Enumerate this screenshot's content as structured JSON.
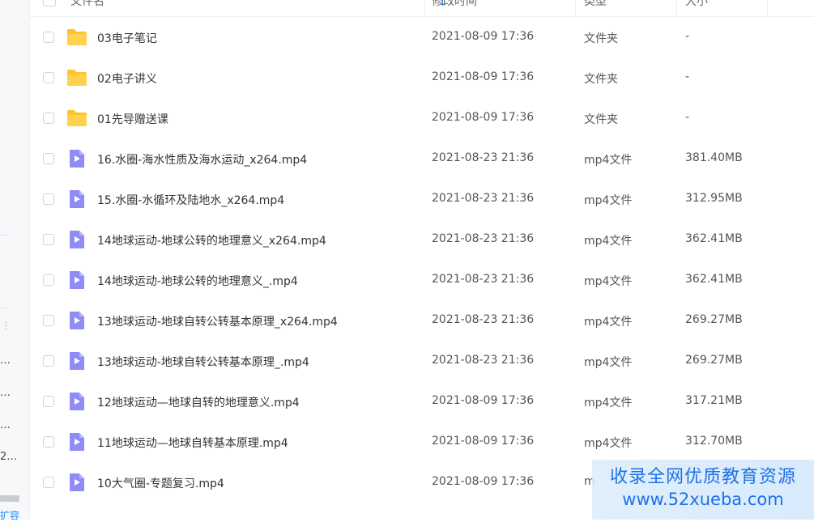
{
  "sidebar": {
    "fragments": [
      "…",
      "…",
      "…",
      "2…"
    ],
    "grip": "⋮",
    "bottom_link": "扩容"
  },
  "header": {
    "name": "文件名",
    "modified": "修改时间",
    "type": "类型",
    "size": "大小",
    "sort_icon": "↓"
  },
  "files": [
    {
      "name": "03电子笔记",
      "date": "2021-08-09 17:36",
      "type": "文件夹",
      "size": "-",
      "icon": "folder-icon"
    },
    {
      "name": "02电子讲义",
      "date": "2021-08-09 17:36",
      "type": "文件夹",
      "size": "-",
      "icon": "folder-icon"
    },
    {
      "name": "01先导赠送课",
      "date": "2021-08-09 17:36",
      "type": "文件夹",
      "size": "-",
      "icon": "folder-icon"
    },
    {
      "name": "16.水圈-海水性质及海水运动_x264.mp4",
      "date": "2021-08-23 21:36",
      "type": "mp4文件",
      "size": "381.40MB",
      "icon": "video-file-icon"
    },
    {
      "name": "15.水圈-水循环及陆地水_x264.mp4",
      "date": "2021-08-23 21:36",
      "type": "mp4文件",
      "size": "312.95MB",
      "icon": "video-file-icon"
    },
    {
      "name": "14地球运动-地球公转的地理意义_x264.mp4",
      "date": "2021-08-23 21:36",
      "type": "mp4文件",
      "size": "362.41MB",
      "icon": "video-file-icon"
    },
    {
      "name": "14地球运动-地球公转的地理意义_.mp4",
      "date": "2021-08-23 21:36",
      "type": "mp4文件",
      "size": "362.41MB",
      "icon": "video-file-icon"
    },
    {
      "name": "13地球运动-地球自转公转基本原理_x264.mp4",
      "date": "2021-08-23 21:36",
      "type": "mp4文件",
      "size": "269.27MB",
      "icon": "video-file-icon"
    },
    {
      "name": "13地球运动-地球自转公转基本原理_.mp4",
      "date": "2021-08-23 21:36",
      "type": "mp4文件",
      "size": "269.27MB",
      "icon": "video-file-icon"
    },
    {
      "name": "12地球运动—地球自转的地理意义.mp4",
      "date": "2021-08-09 17:36",
      "type": "mp4文件",
      "size": "317.21MB",
      "icon": "video-file-icon"
    },
    {
      "name": "11地球运动—地球自转基本原理.mp4",
      "date": "2021-08-09 17:36",
      "type": "mp4文件",
      "size": "312.70MB",
      "icon": "video-file-icon"
    },
    {
      "name": "10大气圈-专题复习.mp4",
      "date": "2021-08-09 17:36",
      "type": "m",
      "size": "",
      "icon": "video-file-icon"
    }
  ],
  "watermark": {
    "line1": "收录全网优质教育资源",
    "line2": "www.52xueba.com"
  },
  "colors": {
    "accent": "#1c8cf5",
    "folder": "#ffc42d",
    "video": "#8f8cf6"
  }
}
